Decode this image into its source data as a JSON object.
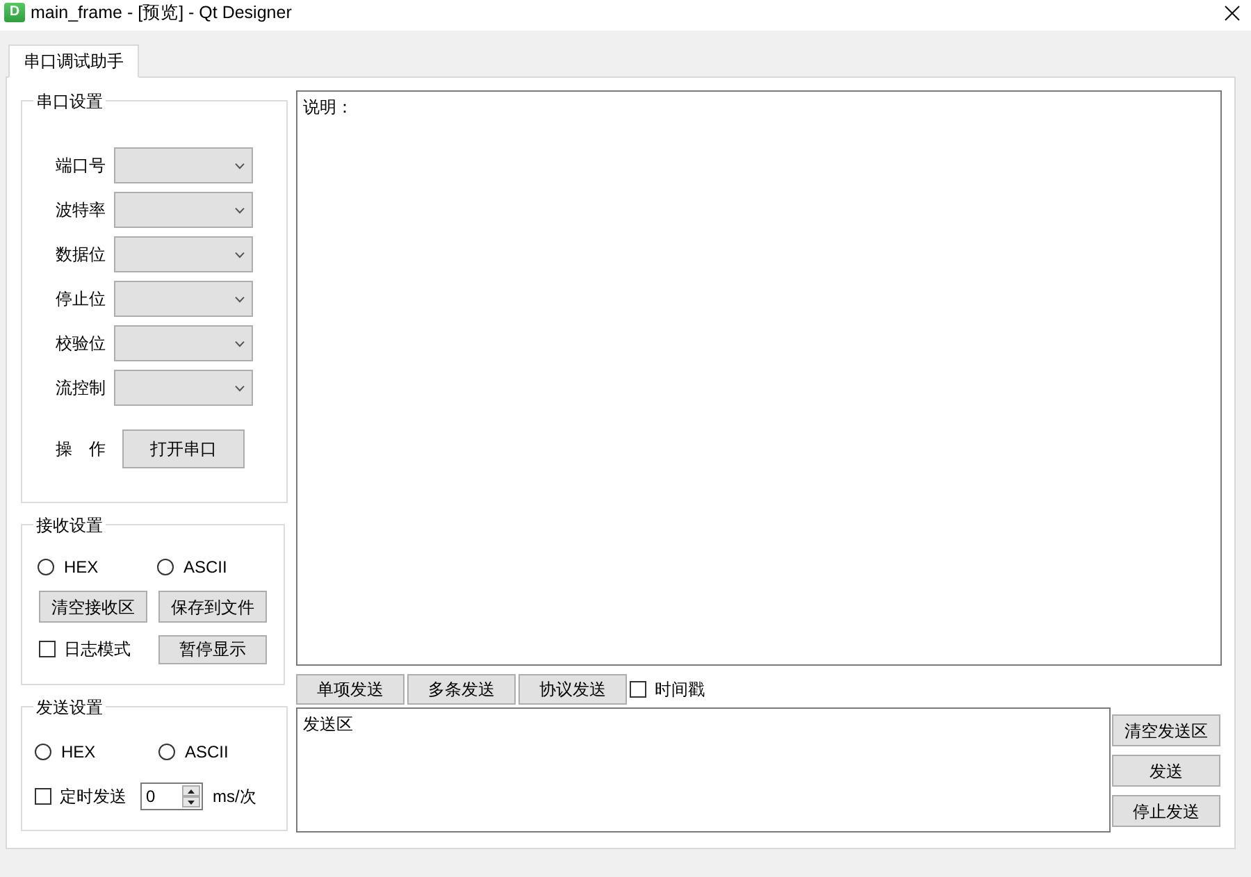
{
  "window": {
    "app_icon": "D",
    "title": "main_frame - [预览] - Qt Designer"
  },
  "tabs": [
    {
      "label": "串口调试助手",
      "selected": true
    }
  ],
  "serial_settings": {
    "title": "串口设置",
    "fields": [
      {
        "label": "端口号"
      },
      {
        "label": "波特率"
      },
      {
        "label": "数据位"
      },
      {
        "label": "停止位"
      },
      {
        "label": "校验位"
      },
      {
        "label": "流控制"
      }
    ],
    "action_label": "操　作",
    "open_button": "打开串口"
  },
  "receive_settings": {
    "title": "接收设置",
    "formats": [
      {
        "label": "HEX",
        "selected": false
      },
      {
        "label": "ASCII",
        "selected": false
      }
    ],
    "clear_button": "清空接收区",
    "save_button": "保存到文件",
    "log_mode": {
      "label": "日志模式",
      "checked": false
    },
    "pause_button": "暂停显示"
  },
  "send_settings": {
    "title": "发送设置",
    "formats": [
      {
        "label": "HEX",
        "selected": false
      },
      {
        "label": "ASCII",
        "selected": false
      }
    ],
    "timed_send": {
      "label": "定时发送",
      "checked": false
    },
    "interval": {
      "value": "0",
      "unit": "ms/次"
    }
  },
  "receive_area": {
    "text": "说明："
  },
  "send_modes": [
    {
      "label": "单项发送"
    },
    {
      "label": "多条发送"
    },
    {
      "label": "协议发送"
    }
  ],
  "timestamp": {
    "label": "时间戳",
    "checked": false
  },
  "send_area": {
    "text": "发送区"
  },
  "send_buttons": [
    {
      "label": "清空发送区"
    },
    {
      "label": "发送"
    },
    {
      "label": "停止发送"
    }
  ]
}
